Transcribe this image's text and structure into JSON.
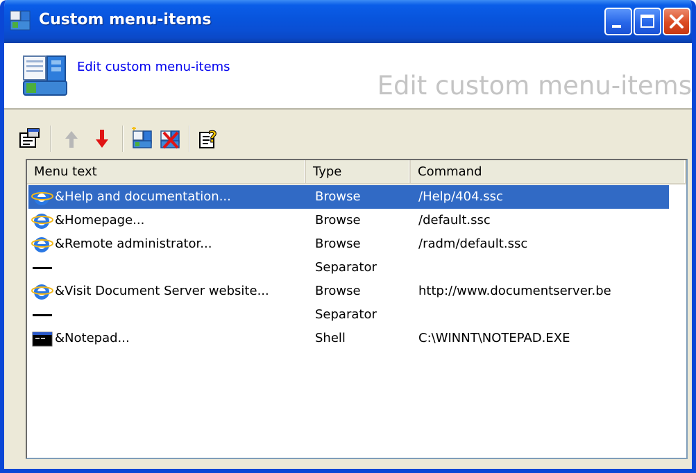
{
  "window": {
    "title": "Custom menu-items"
  },
  "header": {
    "link": "Edit custom menu-items",
    "watermark": "Edit custom menu-items"
  },
  "toolbar": {
    "buttons": [
      "properties-icon",
      "move-up-icon",
      "move-down-icon",
      "add-item-icon",
      "delete-item-icon",
      "help-icon"
    ]
  },
  "list": {
    "columns": [
      "Menu text",
      "Type",
      "Command"
    ],
    "rows": [
      {
        "text": "&Help and documentation...",
        "type": "Browse",
        "command": "/Help/404.ssc",
        "icon": "ie-icon",
        "selected": true
      },
      {
        "text": "&Homepage...",
        "type": "Browse",
        "command": "/default.ssc",
        "icon": "ie-icon"
      },
      {
        "text": "&Remote administrator...",
        "type": "Browse",
        "command": "/radm/default.ssc",
        "icon": "ie-icon"
      },
      {
        "text": "",
        "type": "Separator",
        "command": "",
        "icon": "separator-line-icon"
      },
      {
        "text": "&Visit Document Server website...",
        "type": "Browse",
        "command": "http://www.documentserver.be",
        "icon": "ie-icon"
      },
      {
        "text": "",
        "type": "Separator",
        "command": "",
        "icon": "separator-line-icon"
      },
      {
        "text": "&Notepad...",
        "type": "Shell",
        "command": "C:\\WINNT\\NOTEPAD.EXE",
        "icon": "console-icon"
      }
    ]
  },
  "colors": {
    "titlebar": "#0a4fd4",
    "selection": "#316ac5",
    "link": "#0000ee"
  }
}
